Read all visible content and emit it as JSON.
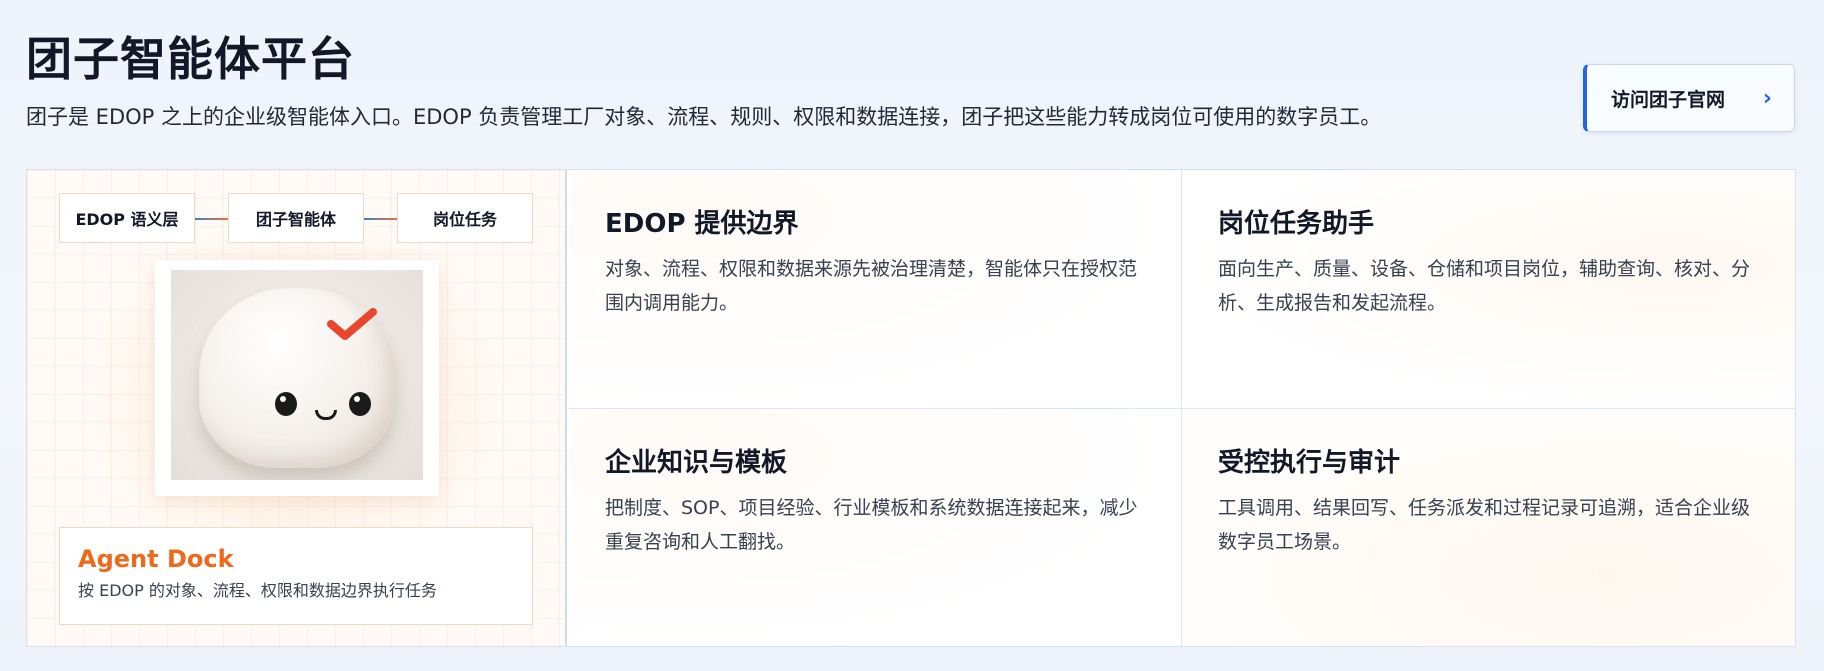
{
  "header": {
    "title": "团子智能体平台",
    "subtitle": "团子是 EDOP 之上的企业级智能体入口。EDOP 负责管理工厂对象、流程、规则、权限和数据连接，团子把这些能力转成岗位可使用的数字员工。"
  },
  "visit_button": {
    "label": "访问团子官网",
    "chevron": "›"
  },
  "flow": {
    "steps": [
      "EDOP 语义层",
      "团子智能体",
      "岗位任务"
    ]
  },
  "dock": {
    "title": "Agent Dock",
    "description": "按 EDOP 的对象、流程、权限和数据边界执行任务"
  },
  "features": [
    {
      "title": "EDOP 提供边界",
      "description": "对象、流程、权限和数据来源先被治理清楚，智能体只在授权范围内调用能力。"
    },
    {
      "title": "岗位任务助手",
      "description": "面向生产、质量、设备、仓储和项目岗位，辅助查询、核对、分析、生成报告和发起流程。"
    },
    {
      "title": "企业知识与模板",
      "description": "把制度、SOP、项目经验、行业模板和系统数据连接起来，减少重复咨询和人工翻找。"
    },
    {
      "title": "受控执行与审计",
      "description": "工具调用、结果回写、任务派发和过程记录可追溯，适合企业级数字员工场景。"
    }
  ],
  "colors": {
    "accent_blue": "#2563eb",
    "accent_orange": "#f0681a",
    "check_red": "#e8452c"
  },
  "icons": {
    "visit_chevron": "chevron-right-icon",
    "mascot_check": "checkmark-icon"
  }
}
